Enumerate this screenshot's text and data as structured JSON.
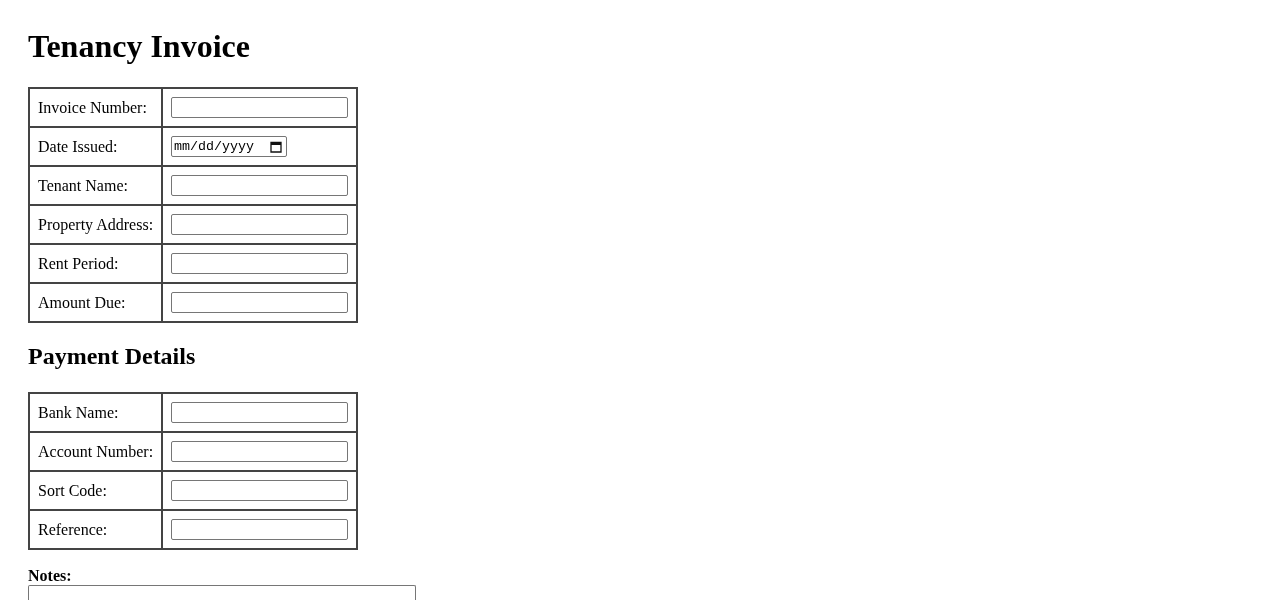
{
  "title": "Tenancy Invoice",
  "invoice_fields": [
    {
      "label": "Invoice Number:",
      "kind": "text"
    },
    {
      "label": "Date Issued:",
      "kind": "date",
      "placeholder": "mm/dd/yyyy"
    },
    {
      "label": "Tenant Name:",
      "kind": "text"
    },
    {
      "label": "Property Address:",
      "kind": "text"
    },
    {
      "label": "Rent Period:",
      "kind": "text"
    },
    {
      "label": "Amount Due:",
      "kind": "text"
    }
  ],
  "payment_details": {
    "heading": "Payment Details",
    "fields": [
      {
        "label": "Bank Name:",
        "kind": "text"
      },
      {
        "label": "Account Number:",
        "kind": "text"
      },
      {
        "label": "Sort Code:",
        "kind": "text"
      },
      {
        "label": "Reference:",
        "kind": "text"
      }
    ]
  },
  "notes": {
    "label": "Notes:"
  }
}
